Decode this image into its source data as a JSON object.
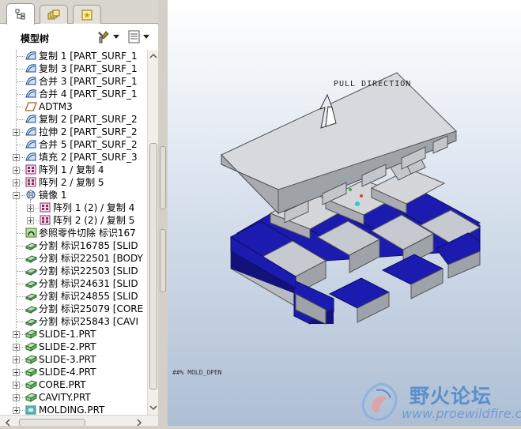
{
  "panel": {
    "title": "模型树",
    "tabs": [
      "model-tree-tab",
      "layers-tab",
      "favorites-tab"
    ]
  },
  "tree": {
    "items": [
      {
        "label": "复制 1 [PART_SURF_1",
        "icon": "surface-icon",
        "expand": "none"
      },
      {
        "label": "复制 3 [PART_SURF_1",
        "icon": "surface-icon",
        "expand": "none"
      },
      {
        "label": "合并 3 [PART_SURF_1",
        "icon": "surface-icon",
        "expand": "none"
      },
      {
        "label": "合并 4 [PART_SURF_1",
        "icon": "surface-icon",
        "expand": "none"
      },
      {
        "label": "ADTM3",
        "icon": "datum-plane-icon",
        "expand": "none"
      },
      {
        "label": "复制 2 [PART_SURF_2",
        "icon": "surface-icon",
        "expand": "none"
      },
      {
        "label": "拉伸 2 [PART_SURF_2",
        "icon": "surface-icon",
        "expand": "plus"
      },
      {
        "label": "合并 5 [PART_SURF_2",
        "icon": "surface-icon",
        "expand": "none"
      },
      {
        "label": "填充 2 [PART_SURF_3",
        "icon": "surface-icon",
        "expand": "plus"
      },
      {
        "label": "阵列 1 / 复制 4",
        "icon": "pattern-icon",
        "expand": "plus"
      },
      {
        "label": "阵列 2 / 复制 5",
        "icon": "pattern-icon",
        "expand": "plus"
      },
      {
        "label": "镜像 1",
        "icon": "mirror-icon",
        "expand": "minus"
      },
      {
        "label": "阵列 1 (2) / 复制 4",
        "icon": "pattern-icon",
        "expand": "plus",
        "indent": 1
      },
      {
        "label": "阵列 2 (2) / 复制 5",
        "icon": "pattern-icon",
        "expand": "plus",
        "indent": 1
      },
      {
        "label": "参照零件切除 标识167",
        "icon": "ref-part-cut-icon",
        "expand": "none"
      },
      {
        "label": "分割 标识16785 [SLID",
        "icon": "split-icon",
        "expand": "none"
      },
      {
        "label": "分割 标识22501 [BODY",
        "icon": "split-icon",
        "expand": "none"
      },
      {
        "label": "分割 标识22503 [SLID",
        "icon": "split-icon",
        "expand": "none"
      },
      {
        "label": "分割 标识24631 [SLID",
        "icon": "split-icon",
        "expand": "none"
      },
      {
        "label": "分割 标识24855 [SLID",
        "icon": "split-icon",
        "expand": "none"
      },
      {
        "label": "分割 标识25079 [CORE",
        "icon": "split-icon",
        "expand": "none"
      },
      {
        "label": "分割 标识25843 [CAVI",
        "icon": "split-icon",
        "expand": "none"
      },
      {
        "label": "SLIDE-1.PRT",
        "icon": "part-icon",
        "expand": "plus"
      },
      {
        "label": "SLIDE-2.PRT",
        "icon": "part-icon",
        "expand": "plus"
      },
      {
        "label": "SLIDE-3.PRT",
        "icon": "part-icon",
        "expand": "plus"
      },
      {
        "label": "SLIDE-4.PRT",
        "icon": "part-icon",
        "expand": "plus"
      },
      {
        "label": "CORE.PRT",
        "icon": "part-icon",
        "expand": "plus"
      },
      {
        "label": "CAVITY.PRT",
        "icon": "part-icon",
        "expand": "plus"
      },
      {
        "label": "MOLDING.PRT",
        "icon": "molding-icon",
        "expand": "plus"
      }
    ]
  },
  "viewport": {
    "pull_direction_label": "PULL DIRECTION",
    "view_name_label": "##% MOLD_OPEN",
    "colors": {
      "cavity": "#d6d9de",
      "core": "#1b1bb0",
      "slide": "#c8c8cc",
      "background_top": "#ffffff",
      "background_bottom": "#adbed4"
    }
  },
  "watermark": {
    "name": "野火论坛",
    "url": "www.proewildfire.cn"
  }
}
